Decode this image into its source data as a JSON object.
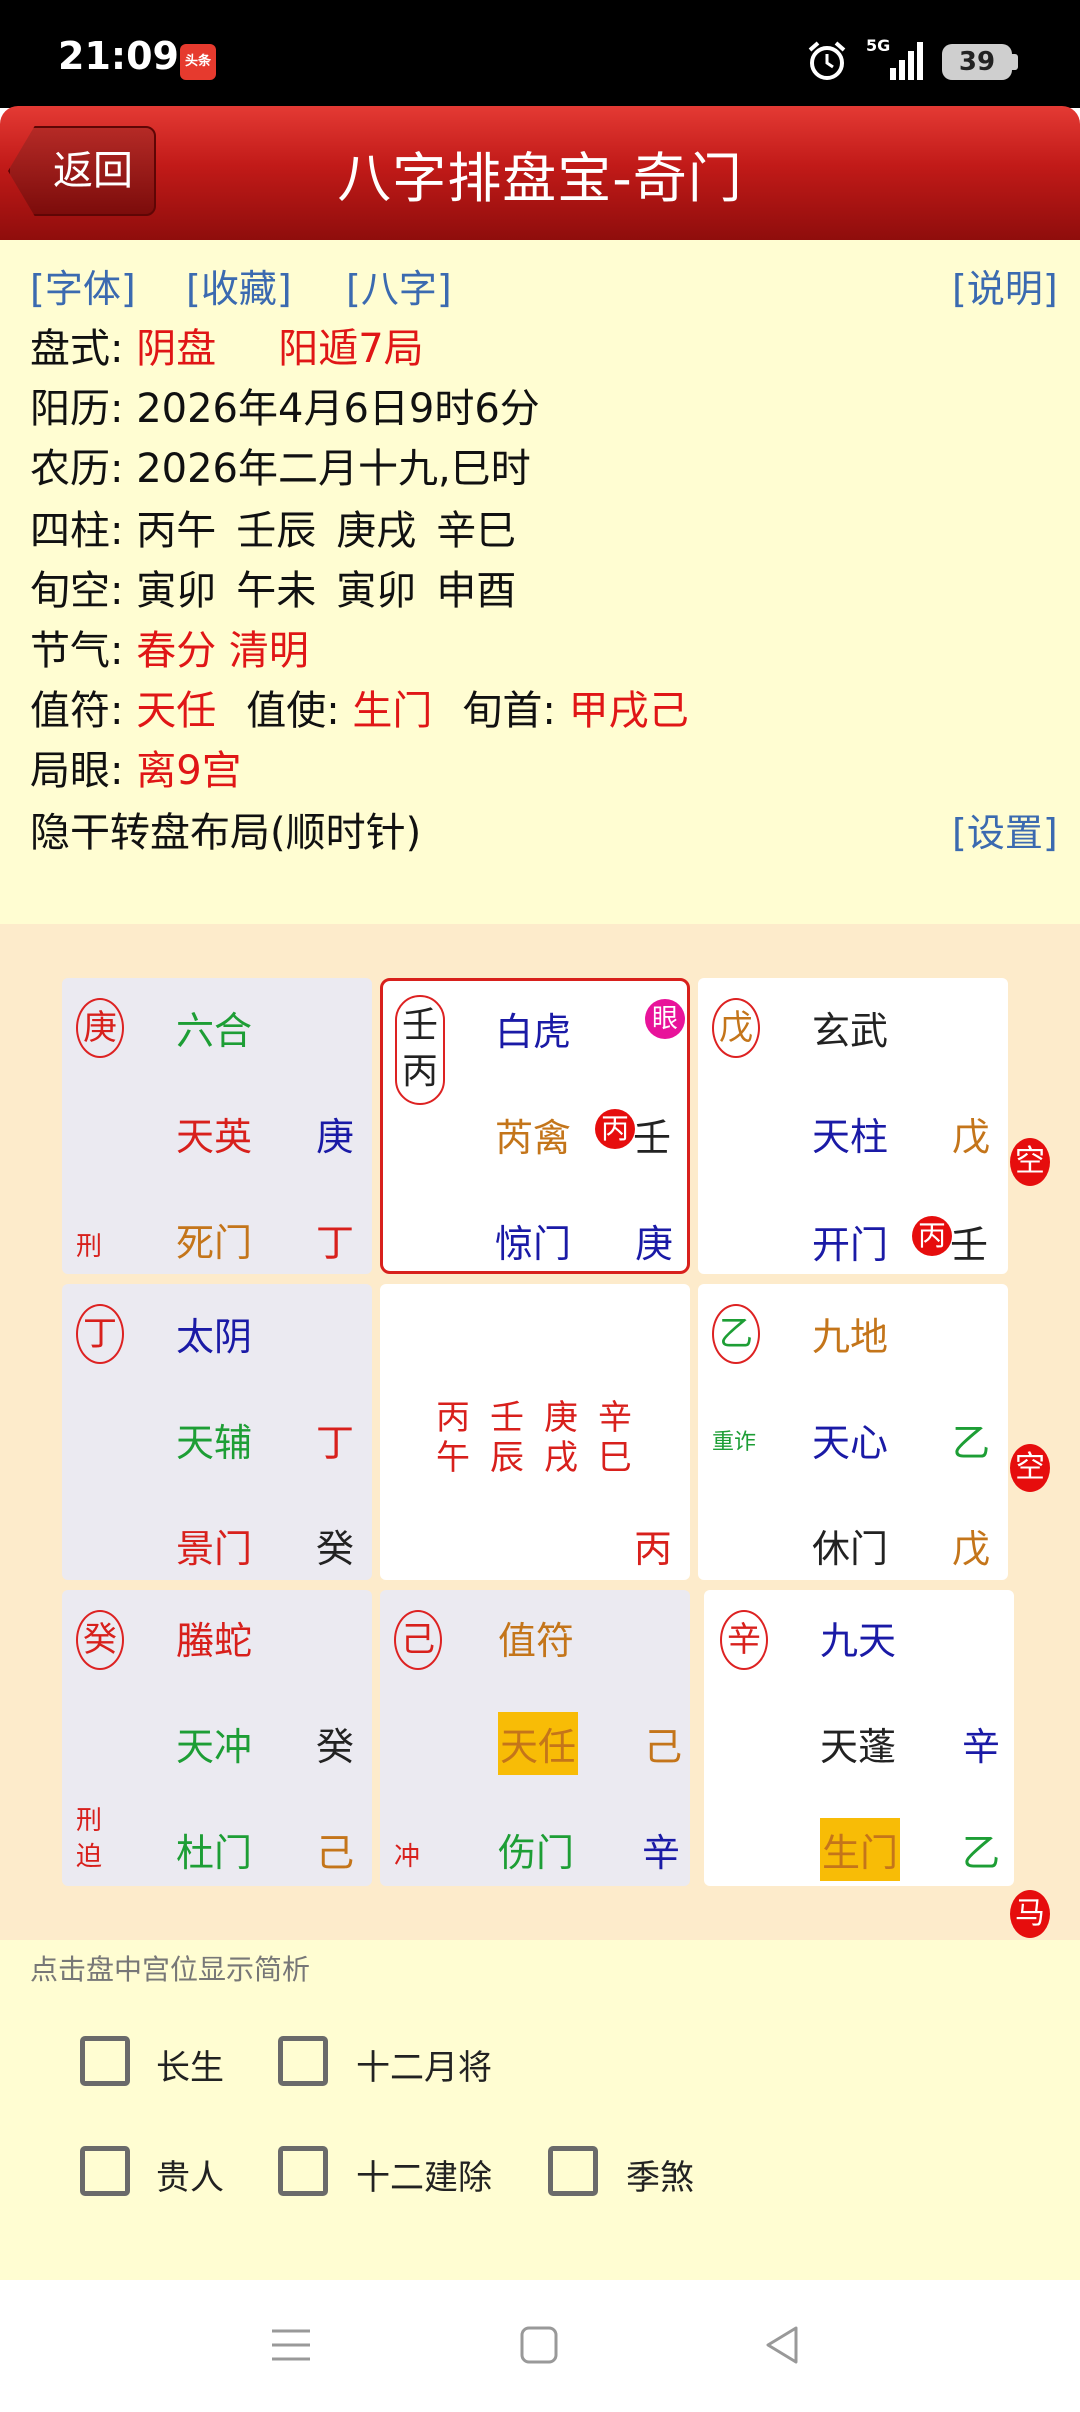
{
  "status_bar": {
    "time": "21:09",
    "app_badge": "头条",
    "network": "5G",
    "battery": "39"
  },
  "header": {
    "back_label": "返回",
    "title": "八字排盘宝-奇门"
  },
  "links": {
    "font": "[字体]",
    "collect": "[收藏]",
    "bazi": "[八字]",
    "help": "[说明]",
    "settings": "[设置]"
  },
  "info": {
    "pan_label": "盘式: ",
    "pan_yin": "阴盘",
    "pan_ju": "阳遁7局",
    "solar_label": "阳历: ",
    "solar_value": "2026年4月6日9时6分",
    "lunar_label": "农历: ",
    "lunar_value": "2026年二月十九,巳时",
    "pillars_label": "四柱: ",
    "pillars": [
      "丙午",
      "壬辰",
      "庚戌",
      "辛巳"
    ],
    "xunkong_label": "旬空: ",
    "xunkong": [
      "寅卯",
      "午未",
      "寅卯",
      "申酉"
    ],
    "jieqi_label": "节气: ",
    "jieqi_value": "春分 清明",
    "zhifu_label": "值符: ",
    "zhifu_value": "天任",
    "zhishi_label": "值使: ",
    "zhishi_value": "生门",
    "xunshou_label": "旬首: ",
    "xunshou_value": "甲戌己",
    "juyan_label": "局眼: ",
    "juyan_value": "离9宫",
    "layout_note": "隐干转盘布局(顺时针)"
  },
  "board": {
    "c1": {
      "circle": "庚",
      "shen": "六合",
      "star": "天英",
      "star_gan": "庚",
      "mark": "刑",
      "door": "死门",
      "door_gan": "丁"
    },
    "c2": {
      "circle_top": "壬",
      "circle_bottom": "丙",
      "shen": "白虎",
      "eye": "眼",
      "star": "芮禽",
      "badge": "丙",
      "star_gan": "壬",
      "door": "惊门",
      "door_gan": "庚"
    },
    "c3": {
      "circle": "戊",
      "shen": "玄武",
      "star": "天柱",
      "star_gan": "戊",
      "door": "开门",
      "badge": "丙",
      "door_gan": "壬",
      "side": "空"
    },
    "c4": {
      "circle": "丁",
      "shen": "太阴",
      "star": "天辅",
      "star_gan": "丁",
      "door": "景门",
      "door_gan": "癸"
    },
    "c5": {
      "stems": [
        "丙",
        "壬",
        "庚",
        "辛"
      ],
      "branches": [
        "午",
        "辰",
        "戌",
        "巳"
      ],
      "gan": "丙"
    },
    "c6": {
      "circle": "乙",
      "shen": "九地",
      "mark": "重诈",
      "star": "天心",
      "star_gan": "乙",
      "door": "休门",
      "door_gan": "戊",
      "side": "空"
    },
    "c7": {
      "circle": "癸",
      "shen": "螣蛇",
      "star": "天冲",
      "star_gan": "癸",
      "mark_top": "刑",
      "mark_bottom": "迫",
      "door": "杜门",
      "door_gan": "己"
    },
    "c8": {
      "circle": "己",
      "shen": "值符",
      "star": "天任",
      "star_gan": "己",
      "mark": "冲",
      "door": "伤门",
      "door_gan": "辛"
    },
    "c9": {
      "circle": "辛",
      "shen": "九天",
      "star": "天蓬",
      "star_gan": "辛",
      "door": "生门",
      "door_gan": "乙",
      "side": "马"
    }
  },
  "hint": "点击盘中宫位显示简析",
  "options": [
    "长生",
    "十二月将",
    "贵人",
    "十二建除",
    "季煞"
  ]
}
